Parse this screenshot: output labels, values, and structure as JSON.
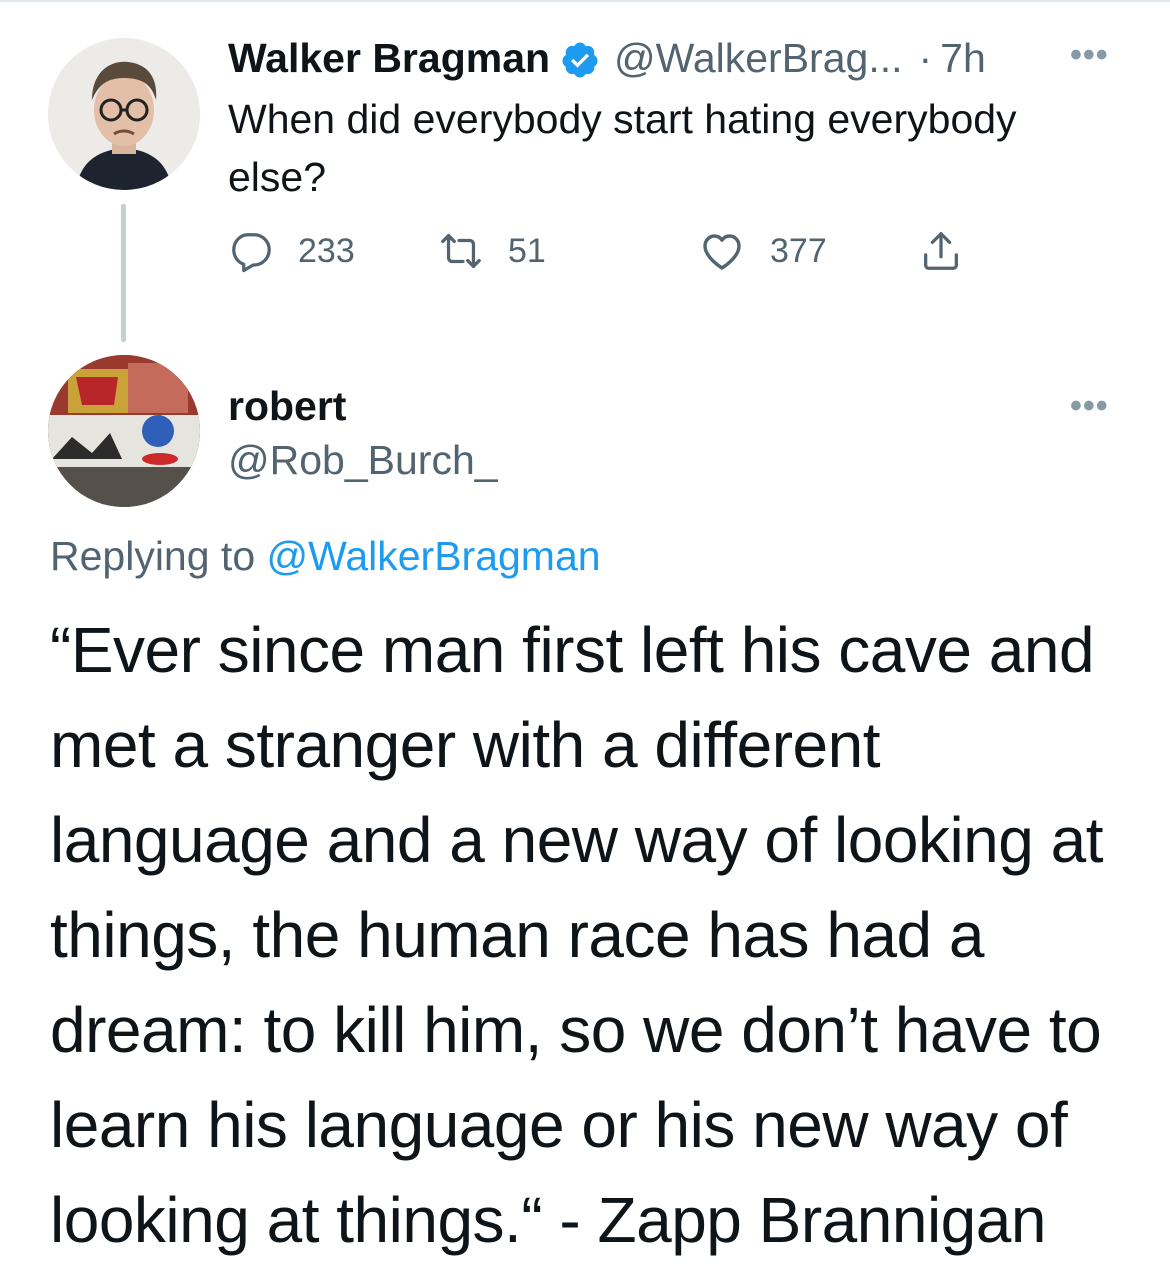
{
  "parent_tweet": {
    "display_name": "Walker Bragman",
    "handle": "@WalkerBrag...",
    "separator": "·",
    "time": "7h",
    "text": "When did everybody start hating everybody else?",
    "stats": {
      "replies": "233",
      "retweets": "51",
      "likes": "377"
    }
  },
  "reply_tweet": {
    "display_name": "robert",
    "handle": "@Rob_Burch_",
    "replying_prefix": "Replying to",
    "replying_to": "@WalkerBragman",
    "text": "“Ever since man first left his cave and met a stranger with a different language and a new way of looking at things, the human race has had a dream: to kill him, so we don’t have to learn his language or his new way of looking at things.“ - Zapp Brannigan"
  },
  "icons": {
    "verified": "verified-badge-icon",
    "more": "more-options-icon",
    "reply": "reply-icon",
    "retweet": "retweet-icon",
    "like": "heart-icon",
    "share": "share-icon"
  },
  "colors": {
    "accent": "#1d9bf0",
    "muted_text": "#536471",
    "thread_line": "#c4cfd6"
  }
}
